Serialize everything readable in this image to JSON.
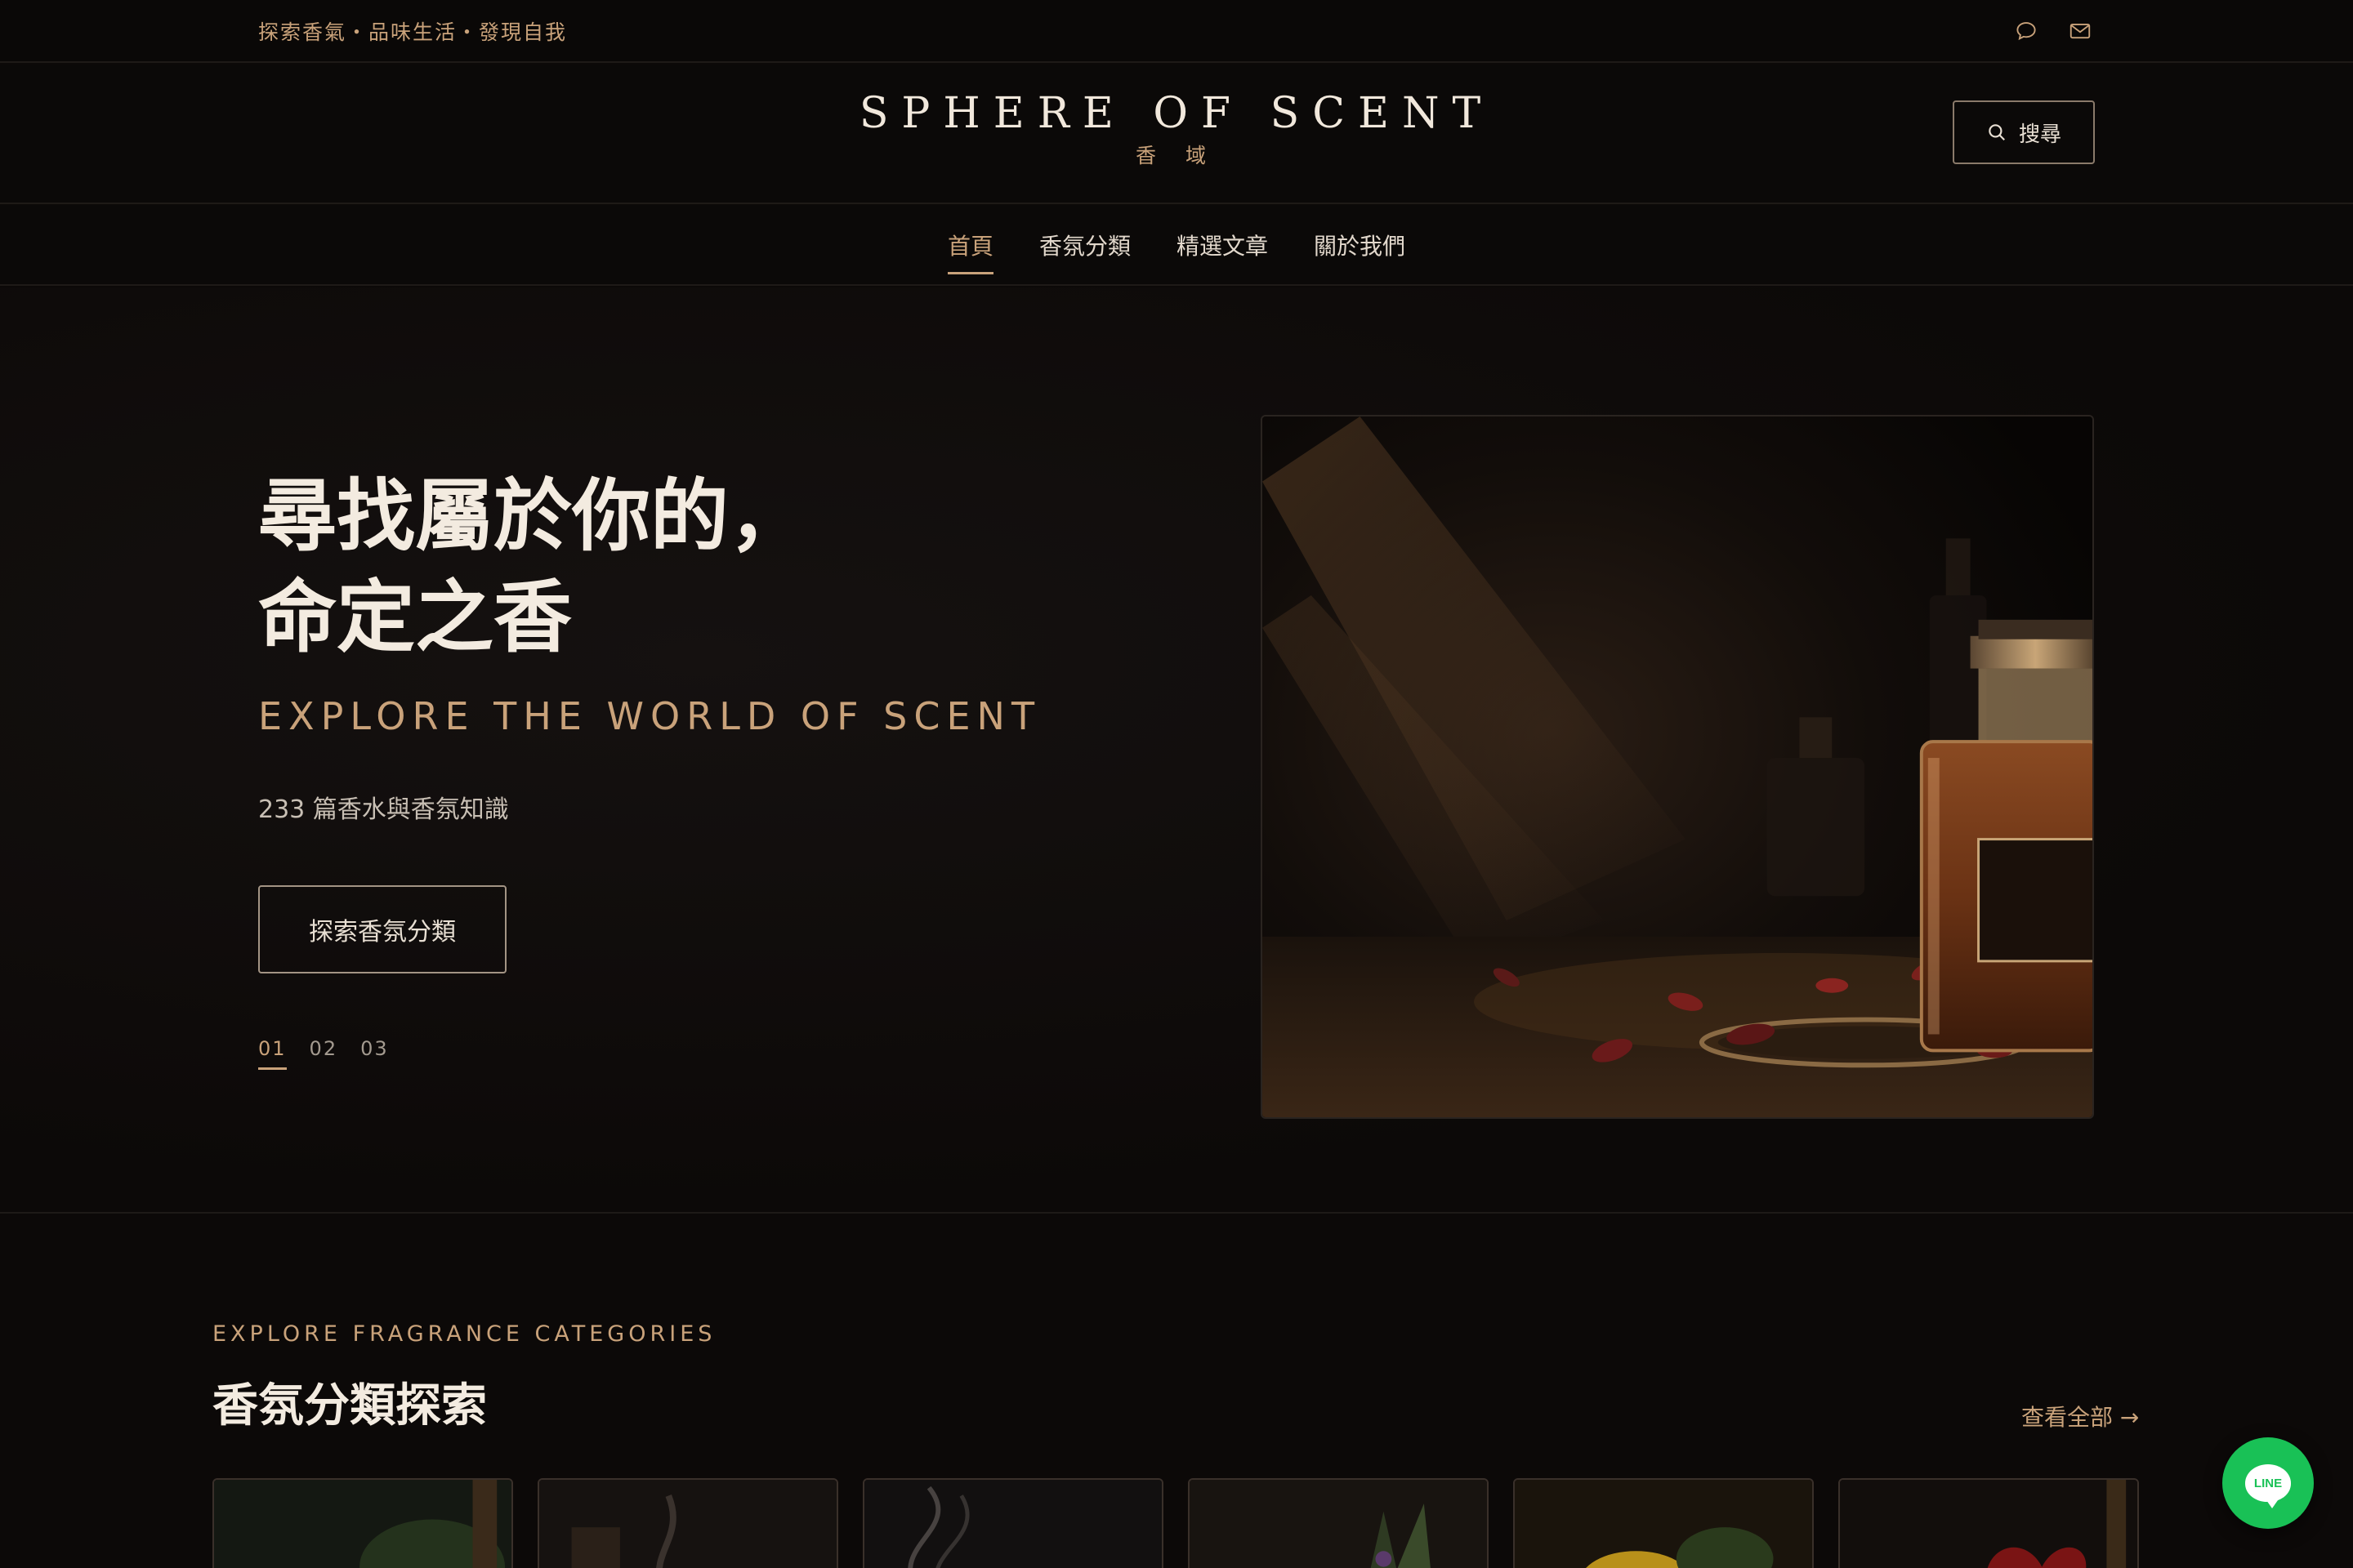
{
  "topbar": {
    "tagline": "探索香氣・品味生活・發現自我",
    "chat_icon": "chat-bubble-icon",
    "mail_icon": "mail-icon"
  },
  "header": {
    "logo_en": "SPHERE OF SCENT",
    "logo_zh": "香 域",
    "search_label": "搜尋",
    "search_icon": "search-icon"
  },
  "nav": {
    "items": [
      {
        "label": "首頁",
        "active": true
      },
      {
        "label": "香氛分類",
        "active": false
      },
      {
        "label": "精選文章",
        "active": false
      },
      {
        "label": "關於我們",
        "active": false
      }
    ]
  },
  "hero": {
    "title_line1": "尋找屬於你的，",
    "title_line2": "命定之香",
    "subtitle": "EXPLORE THE WORLD OF SCENT",
    "count_text": "233 篇香水與香氛知識",
    "cta_label": "探索香氛分類",
    "slides": [
      "01",
      "02",
      "03"
    ],
    "active_slide": "01"
  },
  "categories": {
    "eyebrow": "EXPLORE FRAGRANCE CATEGORIES",
    "title": "香氛分類探索",
    "view_all": "查看全部 →"
  },
  "line_button": {
    "label": "LINE"
  },
  "colors": {
    "accent": "#c9a27a",
    "background": "#0c0908",
    "text": "#e8dfd3",
    "line_green": "#19c156"
  }
}
